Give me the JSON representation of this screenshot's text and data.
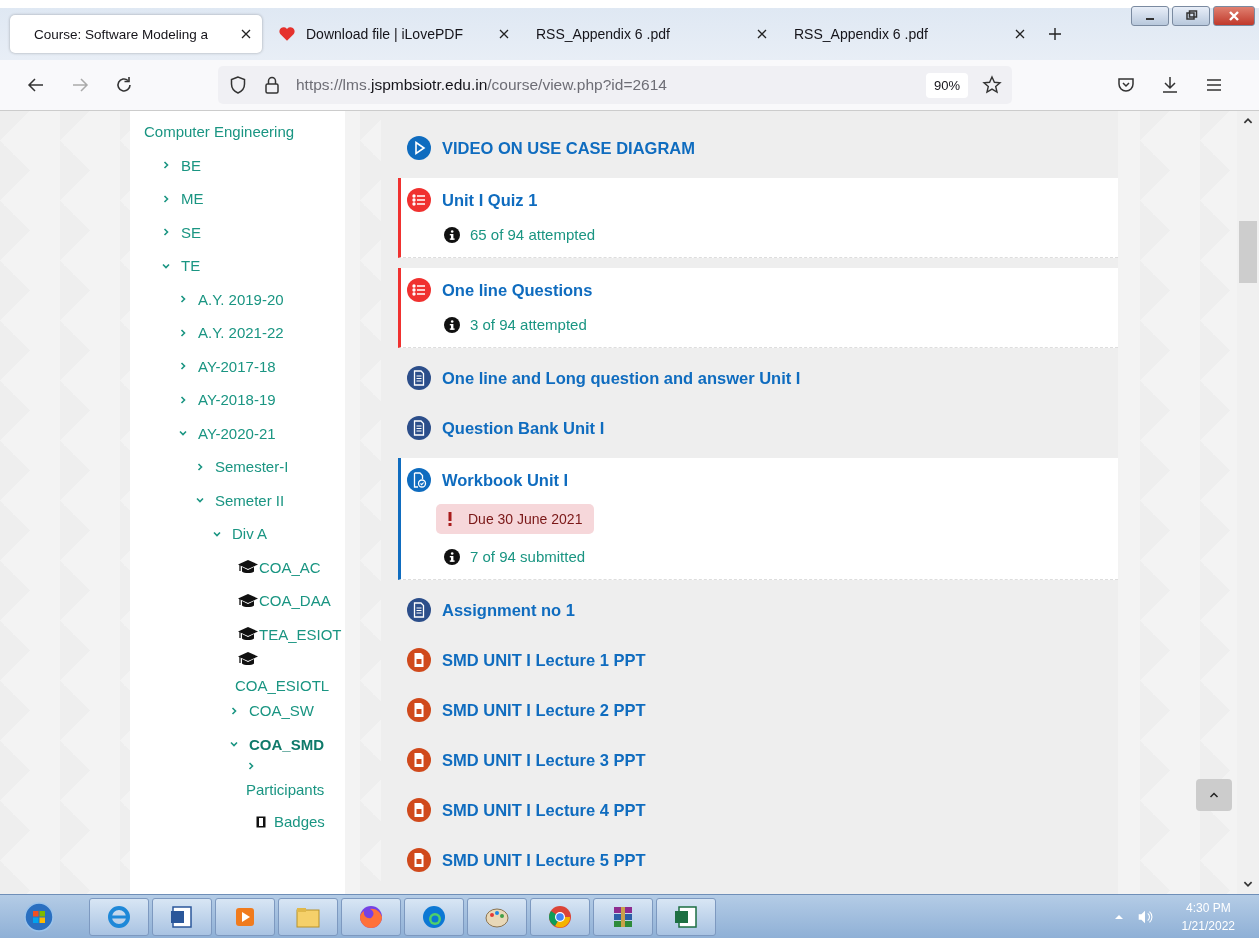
{
  "browser": {
    "tabs": [
      {
        "title": "Course: Software Modeling a",
        "selected": true,
        "favicon": false
      },
      {
        "title": "Download file | iLovePDF",
        "selected": false,
        "favicon": true
      },
      {
        "title": "RSS_Appendix 6 .pdf",
        "selected": false,
        "favicon": false
      },
      {
        "title": "RSS_Appendix 6 .pdf",
        "selected": false,
        "favicon": false
      }
    ],
    "url": {
      "prefix": "https://lms.",
      "domain": "jspmbsiotr.edu.in",
      "path": "/course/view.php?id=2614"
    },
    "zoom": "90%"
  },
  "sidebar": {
    "items": [
      {
        "label": "Computer Engineering",
        "kind": "root",
        "children": [
          {
            "label": "BE",
            "kind": "node",
            "expanded": false,
            "current": false
          },
          {
            "label": "ME",
            "kind": "node",
            "expanded": false,
            "current": false
          },
          {
            "label": "SE",
            "kind": "node",
            "expanded": false,
            "current": false
          },
          {
            "label": "TE",
            "kind": "node",
            "expanded": true,
            "current": false,
            "children": [
              {
                "label": "A.Y. 2019-20",
                "kind": "node",
                "expanded": false,
                "current": false
              },
              {
                "label": "A.Y. 2021-22",
                "kind": "node",
                "expanded": false,
                "current": false
              },
              {
                "label": "AY-2017-18",
                "kind": "node",
                "expanded": false,
                "current": false
              },
              {
                "label": "AY-2018-19",
                "kind": "node",
                "expanded": false,
                "current": false
              },
              {
                "label": "AY-2020-21",
                "kind": "node",
                "expanded": true,
                "current": false,
                "children": [
                  {
                    "label": "Semester-I",
                    "kind": "node",
                    "expanded": false,
                    "current": false
                  },
                  {
                    "label": "Semeter II",
                    "kind": "node",
                    "expanded": true,
                    "current": false,
                    "children": [
                      {
                        "label": "Div A",
                        "kind": "node",
                        "expanded": true,
                        "current": false,
                        "children": [
                          {
                            "label": "COA_AC",
                            "kind": "course",
                            "current": false
                          },
                          {
                            "label": "COA_DAA",
                            "kind": "course",
                            "current": false
                          },
                          {
                            "label": "TEA_ESIOT",
                            "kind": "course",
                            "current": false
                          },
                          {
                            "label": "COA_ESIOTL",
                            "kind": "course-wrapped",
                            "current": false
                          },
                          {
                            "label": "COA_SW",
                            "kind": "node",
                            "expanded": false,
                            "current": false
                          },
                          {
                            "label": "COA_SMD",
                            "kind": "node",
                            "expanded": true,
                            "current": true,
                            "children": [
                              {
                                "label": "Participants",
                                "kind": "node-wrapped",
                                "expanded": false,
                                "current": false
                              },
                              {
                                "label": "Badges",
                                "kind": "badge",
                                "current": false
                              }
                            ]
                          }
                        ]
                      }
                    ]
                  }
                ]
              }
            ]
          }
        ]
      }
    ]
  },
  "activities": [
    {
      "title": "VIDEO ON USE CASE DIAGRAM",
      "kind": "video"
    },
    {
      "title": "Unit I Quiz 1",
      "kind": "quiz",
      "info": "65 of 94 attempted"
    },
    {
      "title": "One line Questions",
      "kind": "quiz",
      "info": "3 of 94 attempted"
    },
    {
      "title": "One line and Long question and answer Unit I",
      "kind": "page"
    },
    {
      "title": "Question Bank Unit I",
      "kind": "page"
    },
    {
      "title": "Workbook Unit I",
      "kind": "assign",
      "due": "Due 30 June 2021",
      "info": "7 of 94 submitted"
    },
    {
      "title": "Assignment no 1",
      "kind": "page"
    },
    {
      "title": "SMD UNIT I Lecture 1 PPT",
      "kind": "ppt"
    },
    {
      "title": "SMD UNIT I Lecture 2 PPT",
      "kind": "ppt"
    },
    {
      "title": "SMD UNIT I Lecture 3 PPT",
      "kind": "ppt"
    },
    {
      "title": "SMD UNIT I Lecture 4 PPT",
      "kind": "ppt"
    },
    {
      "title": "SMD UNIT I Lecture 5 PPT",
      "kind": "ppt"
    }
  ],
  "taskbar": {
    "time": "4:30 PM",
    "date": "1/21/2022"
  }
}
